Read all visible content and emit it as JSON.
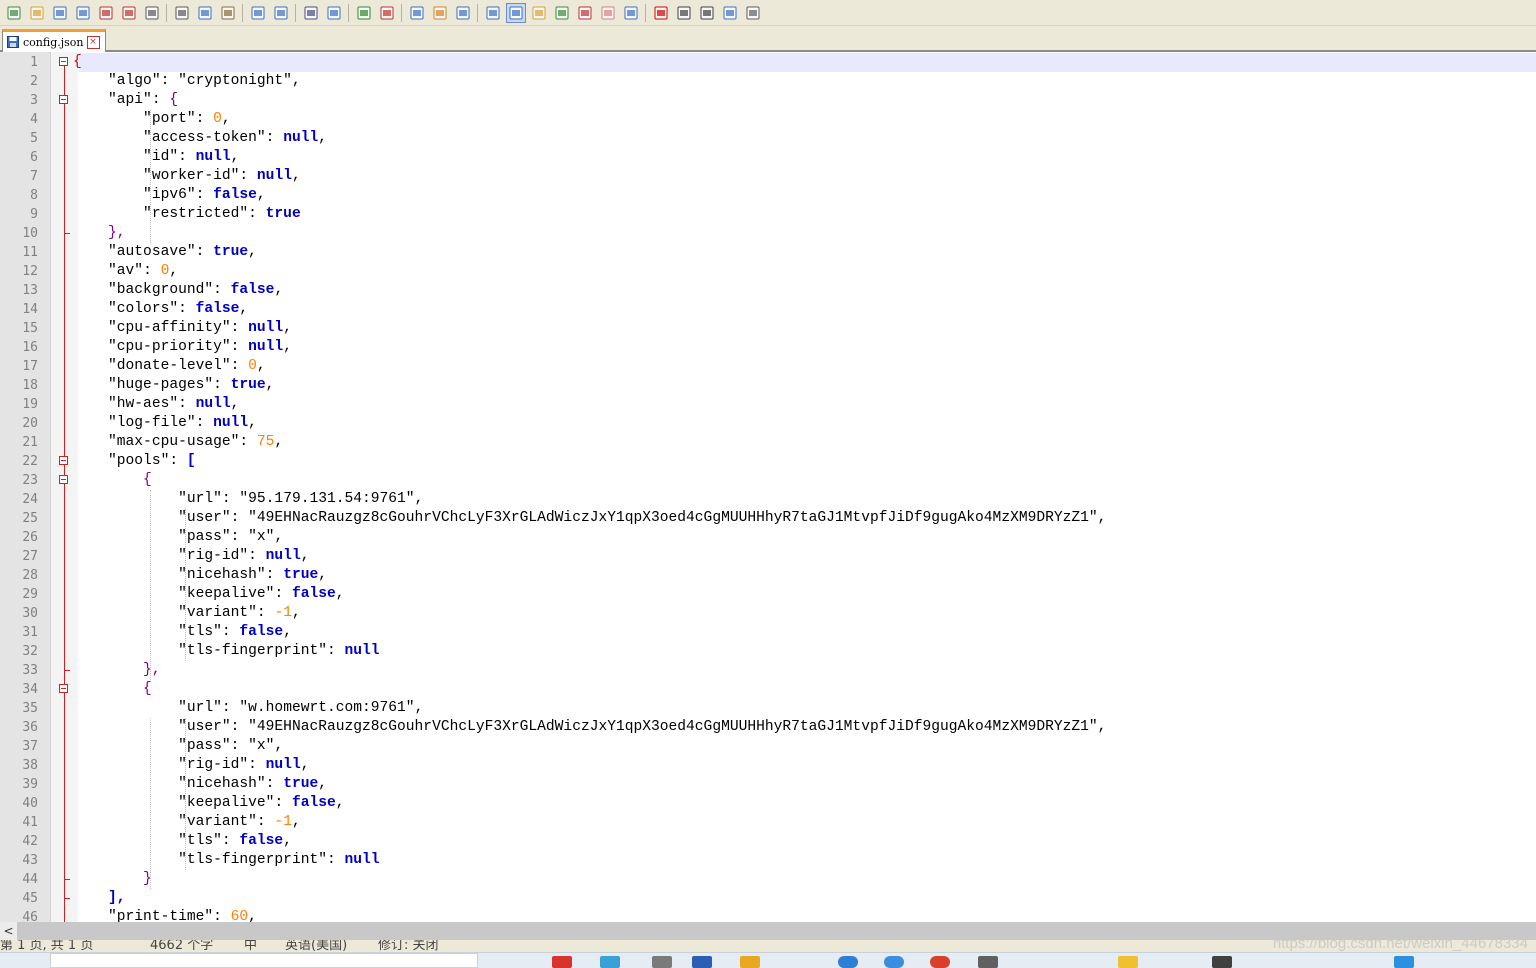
{
  "toolbar": {
    "icons": [
      "new-file-icon",
      "open-file-icon",
      "save-icon",
      "save-all-icon",
      "close-icon",
      "close-all-icon",
      "print-icon",
      "cut-icon",
      "copy-icon",
      "paste-icon",
      "undo-icon",
      "redo-icon",
      "find-icon",
      "replace-icon",
      "zoom-in-icon",
      "zoom-out-icon",
      "sync-vertical-icon",
      "sync-horizontal-icon",
      "word-wrap-icon",
      "show-all-chars-icon",
      "indent-guide-icon",
      "language-icon",
      "doc-map-icon",
      "function-list-icon",
      "folder-workspace-icon",
      "monitoring-icon",
      "record-macro-icon",
      "stop-macro-icon",
      "play-macro-icon",
      "run-macro-multiple-icon",
      "save-macro-icon"
    ]
  },
  "tab": {
    "label": "config.json"
  },
  "editor": {
    "lines": [
      [
        [
          "ob",
          "{"
        ]
      ],
      [
        [
          "str",
          "    \"algo\""
        ],
        [
          "k",
          ": "
        ],
        [
          "str",
          "\"cryptonight\""
        ],
        [
          "k",
          ","
        ]
      ],
      [
        [
          "str",
          "    \"api\""
        ],
        [
          "k",
          ": "
        ],
        [
          "p",
          "{"
        ]
      ],
      [
        [
          "str",
          "        \"port\""
        ],
        [
          "k",
          ": "
        ],
        [
          "n",
          "0"
        ],
        [
          "k",
          ","
        ]
      ],
      [
        [
          "str",
          "        \"access-token\""
        ],
        [
          "k",
          ": "
        ],
        [
          "kw",
          "null"
        ],
        [
          "k",
          ","
        ]
      ],
      [
        [
          "str",
          "        \"id\""
        ],
        [
          "k",
          ": "
        ],
        [
          "kw",
          "null"
        ],
        [
          "k",
          ","
        ]
      ],
      [
        [
          "str",
          "        \"worker-id\""
        ],
        [
          "k",
          ": "
        ],
        [
          "kw",
          "null"
        ],
        [
          "k",
          ","
        ]
      ],
      [
        [
          "str",
          "        \"ipv6\""
        ],
        [
          "k",
          ": "
        ],
        [
          "kw",
          "false"
        ],
        [
          "k",
          ","
        ]
      ],
      [
        [
          "str",
          "        \"restricted\""
        ],
        [
          "k",
          ": "
        ],
        [
          "kw",
          "true"
        ]
      ],
      [
        [
          "p",
          "    },"
        ]
      ],
      [
        [
          "str",
          "    \"autosave\""
        ],
        [
          "k",
          ": "
        ],
        [
          "kw",
          "true"
        ],
        [
          "k",
          ","
        ]
      ],
      [
        [
          "str",
          "    \"av\""
        ],
        [
          "k",
          ": "
        ],
        [
          "n",
          "0"
        ],
        [
          "k",
          ","
        ]
      ],
      [
        [
          "str",
          "    \"background\""
        ],
        [
          "k",
          ": "
        ],
        [
          "kw",
          "false"
        ],
        [
          "k",
          ","
        ]
      ],
      [
        [
          "str",
          "    \"colors\""
        ],
        [
          "k",
          ": "
        ],
        [
          "kw",
          "false"
        ],
        [
          "k",
          ","
        ]
      ],
      [
        [
          "str",
          "    \"cpu-affinity\""
        ],
        [
          "k",
          ": "
        ],
        [
          "kw",
          "null"
        ],
        [
          "k",
          ","
        ]
      ],
      [
        [
          "str",
          "    \"cpu-priority\""
        ],
        [
          "k",
          ": "
        ],
        [
          "kw",
          "null"
        ],
        [
          "k",
          ","
        ]
      ],
      [
        [
          "str",
          "    \"donate-level\""
        ],
        [
          "k",
          ": "
        ],
        [
          "n",
          "0"
        ],
        [
          "k",
          ","
        ]
      ],
      [
        [
          "str",
          "    \"huge-pages\""
        ],
        [
          "k",
          ": "
        ],
        [
          "kw",
          "true"
        ],
        [
          "k",
          ","
        ]
      ],
      [
        [
          "str",
          "    \"hw-aes\""
        ],
        [
          "k",
          ": "
        ],
        [
          "kw",
          "null"
        ],
        [
          "k",
          ","
        ]
      ],
      [
        [
          "str",
          "    \"log-file\""
        ],
        [
          "k",
          ": "
        ],
        [
          "kw",
          "null"
        ],
        [
          "k",
          ","
        ]
      ],
      [
        [
          "str",
          "    \"max-cpu-usage\""
        ],
        [
          "k",
          ": "
        ],
        [
          "n",
          "75"
        ],
        [
          "k",
          ","
        ]
      ],
      [
        [
          "str",
          "    \"pools\""
        ],
        [
          "k",
          ": "
        ],
        [
          "b",
          "["
        ]
      ],
      [
        [
          "p",
          "        {"
        ]
      ],
      [
        [
          "str",
          "            \"url\""
        ],
        [
          "k",
          ": "
        ],
        [
          "str",
          "\"95.179.131.54:9761\""
        ],
        [
          "k",
          ","
        ]
      ],
      [
        [
          "str",
          "            \"user\""
        ],
        [
          "k",
          ": "
        ],
        [
          "str",
          "\"49EHNacRauzgz8cGouhrVChcLyF3XrGLAdWiczJxY1qpX3oed4cGgMUUHHhyR7taGJ1MtvpfJiDf9gugAko4MzXM9DRYzZ1\""
        ],
        [
          "k",
          ","
        ]
      ],
      [
        [
          "str",
          "            \"pass\""
        ],
        [
          "k",
          ": "
        ],
        [
          "str",
          "\"x\""
        ],
        [
          "k",
          ","
        ]
      ],
      [
        [
          "str",
          "            \"rig-id\""
        ],
        [
          "k",
          ": "
        ],
        [
          "kw",
          "null"
        ],
        [
          "k",
          ","
        ]
      ],
      [
        [
          "str",
          "            \"nicehash\""
        ],
        [
          "k",
          ": "
        ],
        [
          "kw",
          "true"
        ],
        [
          "k",
          ","
        ]
      ],
      [
        [
          "str",
          "            \"keepalive\""
        ],
        [
          "k",
          ": "
        ],
        [
          "kw",
          "false"
        ],
        [
          "k",
          ","
        ]
      ],
      [
        [
          "str",
          "            \"variant\""
        ],
        [
          "k",
          ": "
        ],
        [
          "n",
          "-1"
        ],
        [
          "k",
          ","
        ]
      ],
      [
        [
          "str",
          "            \"tls\""
        ],
        [
          "k",
          ": "
        ],
        [
          "kw",
          "false"
        ],
        [
          "k",
          ","
        ]
      ],
      [
        [
          "str",
          "            \"tls-fingerprint\""
        ],
        [
          "k",
          ": "
        ],
        [
          "kw",
          "null"
        ]
      ],
      [
        [
          "p",
          "        },"
        ]
      ],
      [
        [
          "p",
          "        {"
        ]
      ],
      [
        [
          "str",
          "            \"url\""
        ],
        [
          "k",
          ": "
        ],
        [
          "str",
          "\"w.homewrt.com:9761\""
        ],
        [
          "k",
          ","
        ]
      ],
      [
        [
          "str",
          "            \"user\""
        ],
        [
          "k",
          ": "
        ],
        [
          "str",
          "\"49EHNacRauzgz8cGouhrVChcLyF3XrGLAdWiczJxY1qpX3oed4cGgMUUHHhyR7taGJ1MtvpfJiDf9gugAko4MzXM9DRYzZ1\""
        ],
        [
          "k",
          ","
        ]
      ],
      [
        [
          "str",
          "            \"pass\""
        ],
        [
          "k",
          ": "
        ],
        [
          "str",
          "\"x\""
        ],
        [
          "k",
          ","
        ]
      ],
      [
        [
          "str",
          "            \"rig-id\""
        ],
        [
          "k",
          ": "
        ],
        [
          "kw",
          "null"
        ],
        [
          "k",
          ","
        ]
      ],
      [
        [
          "str",
          "            \"nicehash\""
        ],
        [
          "k",
          ": "
        ],
        [
          "kw",
          "true"
        ],
        [
          "k",
          ","
        ]
      ],
      [
        [
          "str",
          "            \"keepalive\""
        ],
        [
          "k",
          ": "
        ],
        [
          "kw",
          "false"
        ],
        [
          "k",
          ","
        ]
      ],
      [
        [
          "str",
          "            \"variant\""
        ],
        [
          "k",
          ": "
        ],
        [
          "n",
          "-1"
        ],
        [
          "k",
          ","
        ]
      ],
      [
        [
          "str",
          "            \"tls\""
        ],
        [
          "k",
          ": "
        ],
        [
          "kw",
          "false"
        ],
        [
          "k",
          ","
        ]
      ],
      [
        [
          "str",
          "            \"tls-fingerprint\""
        ],
        [
          "k",
          ": "
        ],
        [
          "kw",
          "null"
        ]
      ],
      [
        [
          "p",
          "        }"
        ]
      ],
      [
        [
          "b",
          "    ],"
        ]
      ],
      [
        [
          "str",
          "    \"print-time\""
        ],
        [
          "k",
          ": "
        ],
        [
          "n",
          "60"
        ],
        [
          "k",
          ","
        ]
      ]
    ],
    "fold_open_lines": [
      1,
      3,
      22,
      23,
      34
    ],
    "fold_end_lines": [
      10,
      33,
      44,
      45
    ]
  },
  "status": {
    "segments": [
      "第 1 页, 共 1 页",
      "4662 个字",
      "中",
      "英语(美国)",
      "修订: 关闭"
    ]
  },
  "watermark": "https://blog.csdn.net/weixin_44678334",
  "colors": {
    "string": "#000000",
    "number": "#ff8000",
    "keyword": "#0000c0",
    "brace": "#800080",
    "fold": "#d02020"
  }
}
